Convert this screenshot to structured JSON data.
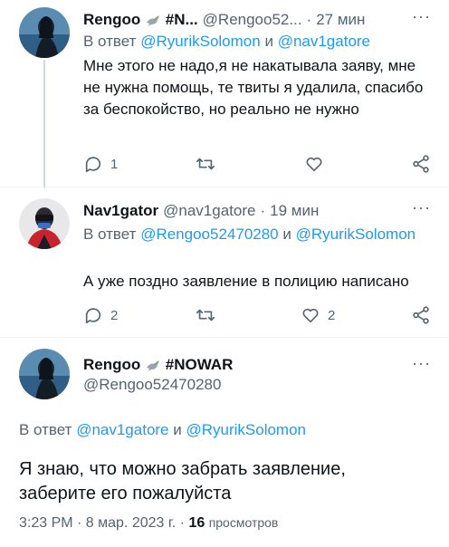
{
  "tweet1": {
    "name": "Rengoo",
    "name_tag": "#N...",
    "handle": "@Rengoo52...",
    "dot": "·",
    "time": "27 мин",
    "more": "···",
    "reply_prefix": "В ответ",
    "reply_mention1": "@RyurikSolomon",
    "reply_and": "и",
    "reply_mention2": "@nav1gatore",
    "text": "Мне этого не надо,я не накатывала заяву, мне не нужна помощь, те твиты я удалила, спасибо за беспокойство, но реально не нужно",
    "reply_count": "1",
    "retweet_count": "",
    "like_count": ""
  },
  "tweet2": {
    "name": "Nav1gator",
    "handle": "@nav1gatore",
    "dot": "·",
    "time": "19 мин",
    "more": "···",
    "reply_prefix": "В ответ",
    "reply_mention1": "@Rengoo52470280",
    "reply_and": "и",
    "reply_mention2": "@RyurikSolomon",
    "text": "А уже поздно заявление в полицию написано",
    "reply_count": "2",
    "retweet_count": "",
    "like_count": "2"
  },
  "tweet3": {
    "name": "Rengoo",
    "name_tag": "#NOWAR",
    "handle": "@Rengoo52470280",
    "more": "···",
    "reply_prefix": "В ответ",
    "reply_mention1": "@nav1gatore",
    "reply_and": "и",
    "reply_mention2": "@RyurikSolomon",
    "text": "Я знаю, что можно забрать заявление, заберите его пожалуйста",
    "timestamp": "3:23 PM · 8 мар. 2023 г. ·",
    "views_count": "16",
    "views_label": "просмотров"
  },
  "icons": {
    "reply": "speech-bubble-icon",
    "retweet": "retweet-icon",
    "like": "heart-icon",
    "share": "share-icon",
    "dove": "dove-icon"
  },
  "colors": {
    "link": "#1d9bf0",
    "muted": "#536471",
    "text": "#0f1419",
    "thread_line": "#cfd9de"
  }
}
